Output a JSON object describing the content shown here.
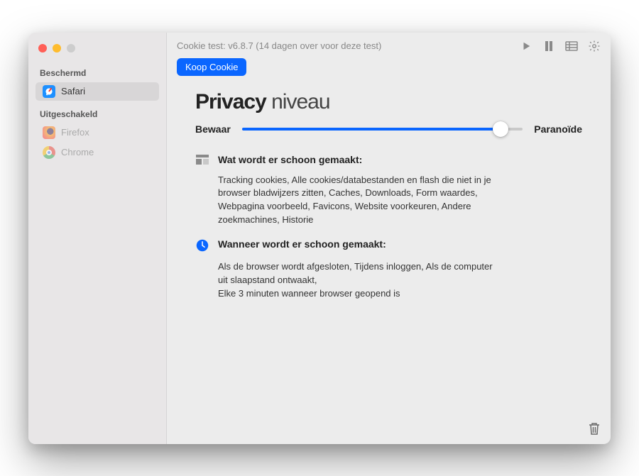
{
  "toolbar": {
    "title": "Cookie test: v6.8.7 (14 dagen over voor deze test)",
    "buy_label": "Koop Cookie",
    "icons": {
      "play": "play-icon",
      "pause": "pause-icon",
      "list": "list-icon",
      "gear": "gear-icon"
    }
  },
  "sidebar": {
    "sections": [
      {
        "label": "Beschermd",
        "items": [
          {
            "name": "Safari",
            "icon": "safari-icon",
            "selected": true
          }
        ]
      },
      {
        "label": "Uitgeschakeld",
        "items": [
          {
            "name": "Firefox",
            "icon": "firefox-icon"
          },
          {
            "name": "Chrome",
            "icon": "chrome-icon"
          }
        ]
      }
    ]
  },
  "content": {
    "heading_bold": "Privacy",
    "heading_light": "niveau",
    "slider": {
      "left_label": "Bewaar",
      "right_label": "Paranoïde",
      "position_percent": 92
    },
    "what": {
      "title": "Wat wordt er schoon gemaakt:",
      "body": "Tracking cookies, Alle cookies/databestanden en flash die niet in je browser bladwijzers zitten, Caches, Downloads, Form waardes, Webpagina voorbeeld, Favicons, Website voorkeuren, Andere zoekmachines, Historie"
    },
    "when": {
      "title": "Wanneer wordt er schoon gemaakt:",
      "body": "Als de browser wordt afgesloten, Tijdens inloggen, Als de computer uit slaapstand ontwaakt,\nElke 3 minuten wanneer browser geopend is"
    }
  }
}
